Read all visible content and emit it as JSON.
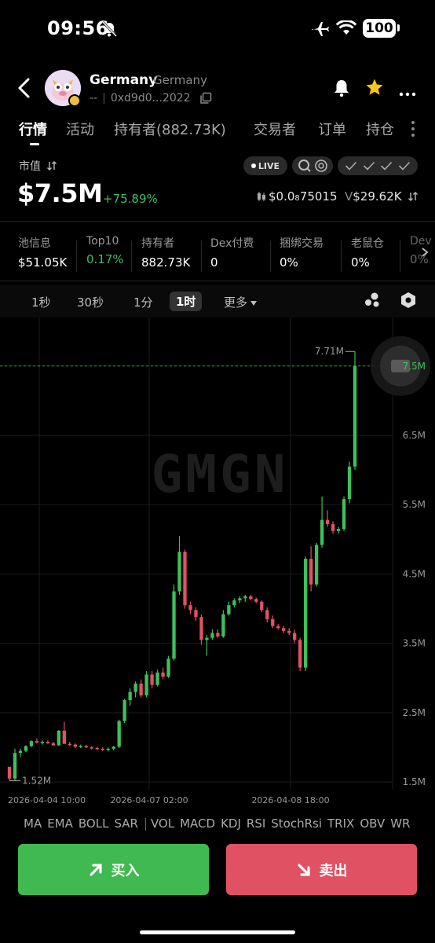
{
  "status_bar": {
    "time": "09:56",
    "battery": "100",
    "icons": [
      "bell-off-icon",
      "airplane-icon",
      "wifi-icon",
      "battery-icon"
    ]
  },
  "header": {
    "token_name": "Germany",
    "token_subname": "Germany",
    "address_prefix": "--",
    "address": "0xd9d0...2022",
    "icons": [
      "back-icon",
      "copy-icon",
      "bell-icon",
      "star-icon",
      "more-icon"
    ],
    "star_color": "#f5c518"
  },
  "tabs": [
    {
      "label": "行情",
      "active": true
    },
    {
      "label": "活动",
      "active": false
    },
    {
      "label": "持有者(882.73K)",
      "active": false
    },
    {
      "label": "交易者",
      "active": false
    },
    {
      "label": "订单",
      "active": false
    },
    {
      "label": "持仓",
      "active": false
    }
  ],
  "market": {
    "label": "市值",
    "value": "$7.5M",
    "change": "+75.89%",
    "live_label": "LIVE",
    "price": "$0.0",
    "price_sub": "8",
    "price_tail": "75015",
    "volume_prefix": "V",
    "volume": "$29.62K",
    "up_color": "#3fbf5b",
    "down_color": "#e05263"
  },
  "info": [
    {
      "label": "池信息",
      "value": "$51.05K"
    },
    {
      "label": "Top10",
      "value": "0.17%"
    },
    {
      "label": "持有者",
      "value": "882.73K"
    },
    {
      "label": "Dex付费",
      "value": "0"
    },
    {
      "label": "捆绑交易",
      "value": "0%"
    },
    {
      "label": "老鼠仓",
      "value": "0%"
    },
    {
      "label": "Dev",
      "value": "0%"
    }
  ],
  "timeframes": {
    "items": [
      "1秒",
      "30秒",
      "1分",
      "1时"
    ],
    "active": "1时",
    "more_label": "更多"
  },
  "chart": {
    "watermark": "GMGN",
    "high_label": "7.71M",
    "low_label": "1.52M",
    "current_label": "7.5M"
  },
  "chart_data": {
    "type": "candlestick",
    "x_labels": [
      "2026-04-04 10:00",
      "2026-04-07 02:00",
      "2026-04-08 18:00"
    ],
    "y_ticks": [
      "1.5M",
      "2.5M",
      "3.5M",
      "4.5M",
      "5.5M",
      "6.5M",
      "7.5M"
    ],
    "ylim": [
      1.4,
      8.2
    ],
    "ohlc": [
      [
        1.72,
        1.72,
        1.52,
        1.55
      ],
      [
        1.55,
        1.98,
        1.52,
        1.92
      ],
      [
        1.92,
        1.98,
        1.86,
        1.95
      ],
      [
        1.95,
        2.03,
        1.93,
        2.02
      ],
      [
        2.02,
        2.1,
        2.0,
        2.09
      ],
      [
        2.09,
        2.13,
        2.06,
        2.07
      ],
      [
        2.07,
        2.1,
        2.04,
        2.08
      ],
      [
        2.08,
        2.1,
        2.05,
        2.06
      ],
      [
        2.06,
        2.08,
        2.02,
        2.03
      ],
      [
        2.03,
        2.25,
        2.02,
        2.24
      ],
      [
        2.24,
        2.37,
        2.05,
        2.05
      ],
      [
        2.05,
        2.08,
        2.02,
        2.04
      ],
      [
        2.04,
        2.06,
        1.99,
        2.01
      ],
      [
        2.01,
        2.04,
        1.99,
        2.02
      ],
      [
        2.02,
        2.04,
        1.99,
        2.0
      ],
      [
        2.0,
        2.02,
        1.97,
        1.99
      ],
      [
        1.99,
        2.01,
        1.96,
        1.98
      ],
      [
        1.98,
        2.0,
        1.95,
        1.97
      ],
      [
        1.97,
        2.0,
        1.94,
        1.98
      ],
      [
        1.98,
        2.02,
        1.96,
        2.01
      ],
      [
        2.01,
        2.4,
        1.99,
        2.38
      ],
      [
        2.38,
        2.7,
        2.35,
        2.68
      ],
      [
        2.68,
        2.85,
        2.6,
        2.8
      ],
      [
        2.8,
        2.95,
        2.72,
        2.92
      ],
      [
        2.92,
        2.98,
        2.72,
        2.75
      ],
      [
        2.75,
        3.1,
        2.72,
        3.05
      ],
      [
        3.05,
        3.1,
        2.85,
        2.9
      ],
      [
        2.9,
        3.12,
        2.88,
        3.08
      ],
      [
        3.08,
        3.15,
        2.98,
        3.02
      ],
      [
        3.02,
        3.32,
        3.0,
        3.28
      ],
      [
        3.28,
        4.35,
        3.25,
        4.25
      ],
      [
        4.25,
        5.05,
        4.2,
        4.82
      ],
      [
        4.82,
        4.85,
        4.0,
        4.05
      ],
      [
        4.05,
        4.1,
        3.92,
        3.98
      ],
      [
        3.98,
        4.02,
        3.82,
        3.88
      ],
      [
        3.88,
        3.92,
        3.48,
        3.55
      ],
      [
        3.55,
        3.62,
        3.32,
        3.58
      ],
      [
        3.58,
        3.7,
        3.55,
        3.65
      ],
      [
        3.65,
        3.7,
        3.58,
        3.6
      ],
      [
        3.6,
        3.98,
        3.58,
        3.92
      ],
      [
        3.92,
        4.1,
        3.9,
        4.05
      ],
      [
        4.05,
        4.15,
        4.02,
        4.12
      ],
      [
        4.12,
        4.18,
        4.08,
        4.15
      ],
      [
        4.15,
        4.2,
        4.1,
        4.18
      ],
      [
        4.18,
        4.2,
        4.12,
        4.14
      ],
      [
        4.14,
        4.16,
        4.08,
        4.1
      ],
      [
        4.1,
        4.12,
        3.95,
        3.98
      ],
      [
        3.98,
        4.02,
        3.8,
        3.85
      ],
      [
        3.85,
        3.9,
        3.72,
        3.75
      ],
      [
        3.75,
        3.78,
        3.7,
        3.72
      ],
      [
        3.72,
        3.75,
        3.65,
        3.68
      ],
      [
        3.68,
        3.72,
        3.62,
        3.65
      ],
      [
        3.65,
        3.7,
        3.5,
        3.55
      ],
      [
        3.55,
        3.58,
        3.1,
        3.15
      ],
      [
        3.15,
        4.75,
        3.1,
        4.72
      ],
      [
        4.72,
        4.9,
        4.25,
        4.35
      ],
      [
        4.35,
        4.95,
        4.32,
        4.92
      ],
      [
        4.92,
        5.62,
        4.88,
        5.28
      ],
      [
        5.28,
        5.42,
        5.18,
        5.22
      ],
      [
        5.22,
        5.26,
        5.08,
        5.12
      ],
      [
        5.12,
        5.18,
        5.08,
        5.15
      ],
      [
        5.15,
        5.62,
        5.12,
        5.58
      ],
      [
        5.58,
        6.12,
        5.52,
        6.05
      ],
      [
        6.05,
        7.71,
        6.0,
        7.5
      ]
    ]
  },
  "indicators": [
    "MA",
    "EMA",
    "BOLL",
    "SAR",
    "VOL",
    "MACD",
    "KDJ",
    "RSI",
    "StochRsi",
    "TRIX",
    "OBV",
    "WR"
  ],
  "actions": {
    "buy_label": "买入",
    "sell_label": "卖出",
    "buy_color": "#3fb950",
    "sell_color": "#e05263"
  }
}
